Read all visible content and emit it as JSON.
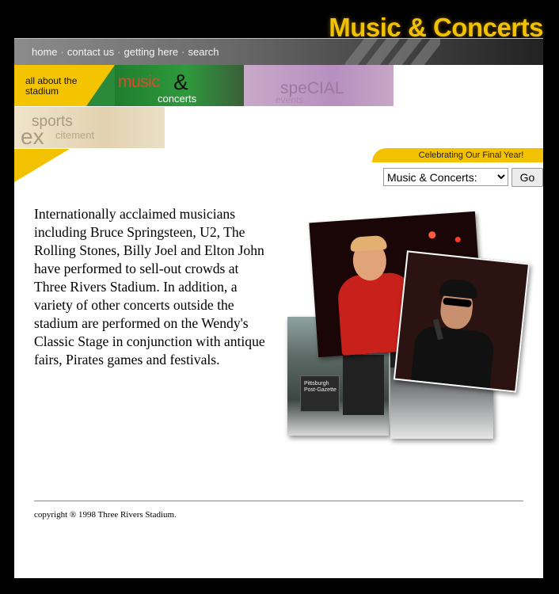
{
  "header": {
    "title": "Music & Concerts",
    "nav": [
      "home",
      "contact us",
      "getting here",
      "search"
    ],
    "nav_separator": "·"
  },
  "tiles": {
    "stadium": {
      "line1": "all about the",
      "line2": "stadium"
    },
    "music": {
      "word1": "music",
      "amp": "&",
      "word2": "concerts"
    },
    "special": {
      "word1": "speCIAL",
      "word2": "events"
    },
    "sports": {
      "word1": "sports",
      "word2": "ex",
      "word3": "citement"
    }
  },
  "banner": {
    "text": "Celebrating Our Final Year!"
  },
  "jump_menu": {
    "selected": "Music & Concerts:",
    "go_label": "Go"
  },
  "main": {
    "body": "Internationally acclaimed musicians including Bruce Springsteen, U2, The Rolling Stones, Billy Joel and Elton John have performed to sell-out crowds at Three Rivers Stadium. In addition, a variety of other concerts outside the stadium are performed on the Wendy's Classic Stage in conjunction with antique fairs, Pirates games and festivals."
  },
  "collage": {
    "sign_text": "Pittsburgh Post-Gazette"
  },
  "footer": {
    "copyright": "copyright ® 1998 Three Rivers Stadium."
  },
  "colors": {
    "accent_yellow": "#f2c200",
    "frame": "#000000"
  }
}
